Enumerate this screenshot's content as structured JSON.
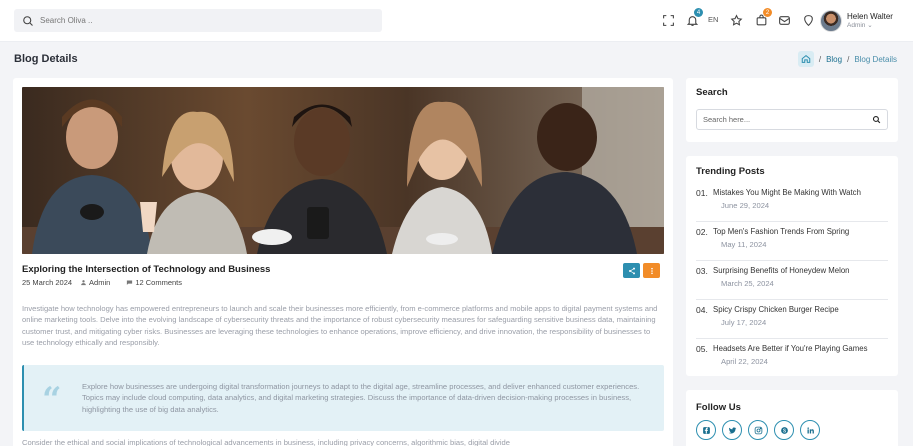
{
  "topbar": {
    "search_placeholder": "Search Oliva ..",
    "notifications_count": "4",
    "language": "EN",
    "cart_count": "2",
    "user_name": "Helen Walter",
    "user_role": "Admin",
    "colors": {
      "notif_badge": "#2d8fb0",
      "cart_badge": "#f28c28"
    }
  },
  "page": {
    "title": "Blog Details",
    "breadcrumb": [
      "Blog",
      "Blog Details"
    ]
  },
  "post": {
    "title": "Exploring the Intersection of Technology and Business",
    "date": "25 March 2024",
    "author": "Admin",
    "comments": "12 Comments",
    "paragraph1": "Investigate how technology has empowered entrepreneurs to launch and scale their businesses more efficiently, from e-commerce platforms and mobile apps to digital payment systems and online marketing tools. Delve into the evolving landscape of cybersecurity threats and the importance of robust cybersecurity measures for safeguarding sensitive business data, maintaining customer trust, and mitigating cyber risks. Businesses are leveraging these technologies to enhance operations, improve efficiency, and drive innovation, the responsibility of businesses to use technology ethically and responsibly.",
    "quote": "Explore how businesses are undergoing digital transformation journeys to adapt to the digital age, streamline processes, and deliver enhanced customer experiences. Topics may include cloud computing, data analytics, and digital marketing strategies. Discuss the importance of data-driven decision-making processes in business, highlighting the use of big data analytics.",
    "paragraph2": "Consider the ethical and social implications of technological advancements in business, including privacy concerns, algorithmic bias, digital divide",
    "colors": {
      "share_button": "#2d8fb0",
      "more_button": "#f28c28"
    }
  },
  "sidebar": {
    "search_title": "Search",
    "search_placeholder": "Search here...",
    "trending_title": "Trending Posts",
    "trending": [
      {
        "num": "01.",
        "title": "Mistakes You Might Be Making With Watch",
        "date": "June 29, 2024"
      },
      {
        "num": "02.",
        "title": "Top Men's Fashion Trends From Spring",
        "date": "May 11, 2024"
      },
      {
        "num": "03.",
        "title": "Surprising Benefits of Honeydew Melon",
        "date": "March 25, 2024"
      },
      {
        "num": "04.",
        "title": "Spicy Crispy Chicken Burger Recipe",
        "date": "July 17, 2024"
      },
      {
        "num": "05.",
        "title": "Headsets Are Better if You're Playing Games",
        "date": "April 22, 2024"
      }
    ],
    "follow_title": "Follow Us",
    "social_icons": [
      "facebook-icon",
      "twitter-icon",
      "instagram-icon",
      "skype-icon",
      "linkedin-icon"
    ]
  },
  "accent_color": "#2d8fb0"
}
